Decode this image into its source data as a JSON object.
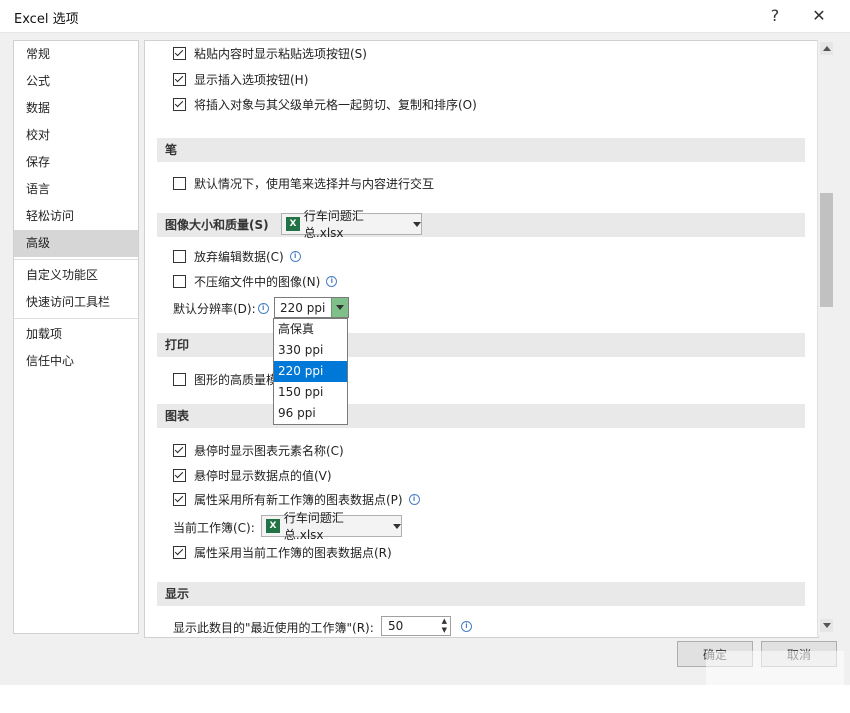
{
  "window": {
    "title": "Excel 选项",
    "help": "?",
    "close": "✕"
  },
  "sidebar": {
    "items": [
      {
        "label": "常规"
      },
      {
        "label": "公式"
      },
      {
        "label": "数据"
      },
      {
        "label": "校对"
      },
      {
        "label": "保存"
      },
      {
        "label": "语言"
      },
      {
        "label": "轻松访问"
      },
      {
        "label": "高级"
      },
      {
        "label": "自定义功能区"
      },
      {
        "label": "快速访问工具栏"
      },
      {
        "label": "加载项"
      },
      {
        "label": "信任中心"
      }
    ],
    "active": "高级"
  },
  "content": {
    "cut_copy": {
      "paste_btn": "粘贴内容时显示粘贴选项按钮(S)",
      "insert_btn": "显示插入选项按钮(H)",
      "cut_sort": "将插入对象与其父级单元格一起剪切、复制和排序(O)"
    },
    "pen": {
      "header": "笔",
      "default_pen": "默认情况下，使用笔来选择并与内容进行交互"
    },
    "image": {
      "header": "图像大小和质量(S)",
      "workbook": "行车问题汇总.xlsx",
      "discard": "放弃编辑数据(C)",
      "no_compress": "不压缩文件中的图像(N)",
      "resolution_label": "默认分辨率(D):",
      "resolution_value": "220 ppi",
      "options": [
        "高保真",
        "330 ppi",
        "220 ppi",
        "150 ppi",
        "96 ppi"
      ],
      "selected_option": "220 ppi"
    },
    "print": {
      "header": "打印",
      "hq_graphics": "图形的高质量模"
    },
    "chart": {
      "header": "图表",
      "hover_names": "悬停时显示图表元素名称(C)",
      "hover_values": "悬停时显示数据点的值(V)",
      "all_workbooks": "属性采用所有新工作簿的图表数据点(P)",
      "current_label": "当前工作簿(C):",
      "current_workbook": "行车问题汇总.xlsx",
      "current_props": "属性采用当前工作簿的图表数据点(R)"
    },
    "display": {
      "header": "显示",
      "recent_label": "显示此数目的\"最近使用的工作簿\"(R):",
      "recent_value": "50"
    }
  },
  "footer": {
    "ok": "确定",
    "cancel": "取消"
  }
}
